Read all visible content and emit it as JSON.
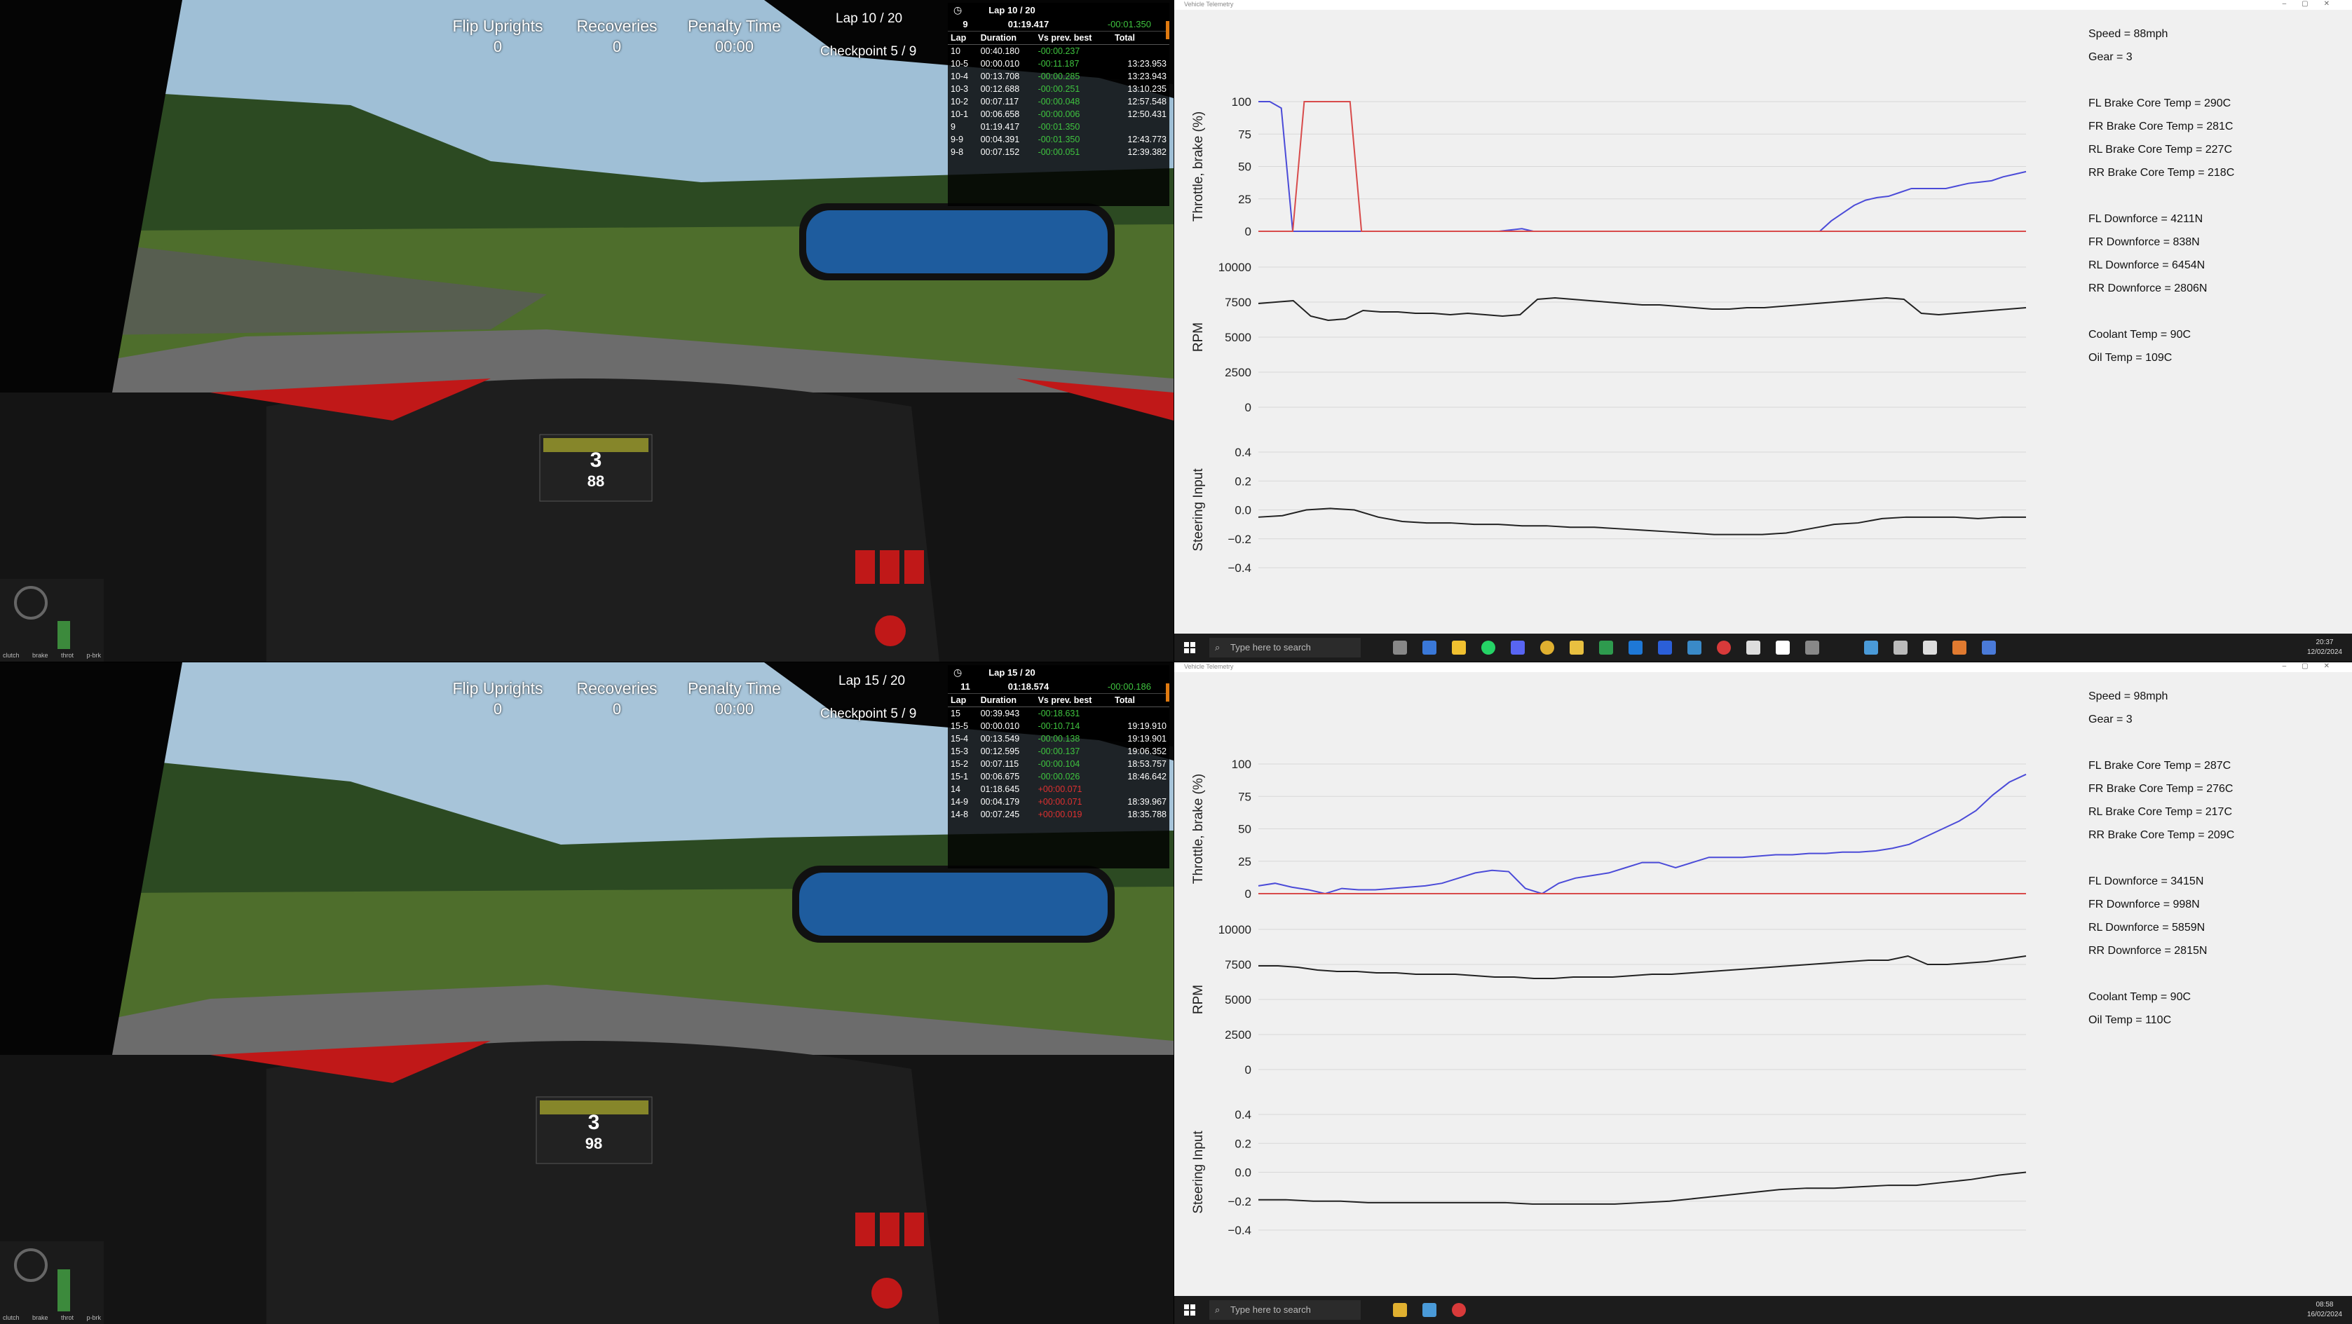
{
  "top": {
    "hud": {
      "flip_label": "Flip Uprights",
      "flip_value": "0",
      "rec_label": "Recoveries",
      "rec_value": "0",
      "pen_label": "Penalty Time",
      "pen_value": "00:00",
      "lap": "Lap 10 / 20",
      "checkpoint": "Checkpoint 5 / 9"
    },
    "lapbox": {
      "title": "Lap 10 / 20",
      "best_lap": "9",
      "best_time": "01:19.417",
      "best_delta": "-00:01.350",
      "headers": [
        "Lap",
        "Duration",
        "Vs prev. best",
        "Total"
      ],
      "rows": [
        {
          "lap": "10",
          "dur": "00:40.180",
          "vs": "-00:00.237",
          "tot": "",
          "vc": "green"
        },
        {
          "lap": "10-5",
          "dur": "00:00.010",
          "vs": "-00:11.187",
          "tot": "13:23.953",
          "vc": "green"
        },
        {
          "lap": "10-4",
          "dur": "00:13.708",
          "vs": "-00:00.285",
          "tot": "13:23.943",
          "vc": "green"
        },
        {
          "lap": "10-3",
          "dur": "00:12.688",
          "vs": "-00:00.251",
          "tot": "13:10.235",
          "vc": "green"
        },
        {
          "lap": "10-2",
          "dur": "00:07.117",
          "vs": "-00:00.048",
          "tot": "12:57.548",
          "vc": "green"
        },
        {
          "lap": "10-1",
          "dur": "00:06.658",
          "vs": "-00:00.006",
          "tot": "12:50.431",
          "vc": "green"
        },
        {
          "lap": "9",
          "dur": "01:19.417",
          "vs": "-00:01.350",
          "tot": "",
          "vc": "green"
        },
        {
          "lap": "9-9",
          "dur": "00:04.391",
          "vs": "-00:01.350",
          "tot": "12:43.773",
          "vc": "green"
        },
        {
          "lap": "9-8",
          "dur": "00:07.152",
          "vs": "-00:00.051",
          "tot": "12:39.382",
          "vc": "green"
        }
      ]
    },
    "dash": {
      "gear": "3",
      "speed": "88"
    },
    "readouts": [
      "Speed = 88mph",
      "Gear = 3",
      "",
      "FL Brake Core Temp = 290C",
      "FR Brake Core Temp = 281C",
      "RL Brake Core Temp = 227C",
      "RR Brake Core Temp = 218C",
      "",
      "FL Downforce = 4211N",
      "FR Downforce = 838N",
      "RL Downforce = 6454N",
      "RR Downforce = 2806N",
      "",
      "Coolant Temp = 90C",
      "Oil Temp = 109C"
    ],
    "window_title": "Vehicle Telemetry",
    "clock": [
      "20:37",
      "12/02/2024"
    ]
  },
  "bottom": {
    "hud": {
      "flip_label": "Flip Uprights",
      "flip_value": "0",
      "rec_label": "Recoveries",
      "rec_value": "0",
      "pen_label": "Penalty Time",
      "pen_value": "00:00",
      "lap": "Lap 15 / 20",
      "checkpoint": "Checkpoint 5 / 9"
    },
    "lapbox": {
      "title": "Lap 15 / 20",
      "best_lap": "11",
      "best_time": "01:18.574",
      "best_delta": "-00:00.186",
      "headers": [
        "Lap",
        "Duration",
        "Vs prev. best",
        "Total"
      ],
      "rows": [
        {
          "lap": "15",
          "dur": "00:39.943",
          "vs": "-00:18.631",
          "tot": "",
          "vc": "green"
        },
        {
          "lap": "15-5",
          "dur": "00:00.010",
          "vs": "-00:10.714",
          "tot": "19:19.910",
          "vc": "green"
        },
        {
          "lap": "15-4",
          "dur": "00:13.549",
          "vs": "-00:00.138",
          "tot": "19:19.901",
          "vc": "green"
        },
        {
          "lap": "15-3",
          "dur": "00:12.595",
          "vs": "-00:00.137",
          "tot": "19:06.352",
          "vc": "green"
        },
        {
          "lap": "15-2",
          "dur": "00:07.115",
          "vs": "-00:00.104",
          "tot": "18:53.757",
          "vc": "green"
        },
        {
          "lap": "15-1",
          "dur": "00:06.675",
          "vs": "-00:00.026",
          "tot": "18:46.642",
          "vc": "green"
        },
        {
          "lap": "14",
          "dur": "01:18.645",
          "vs": "+00:00.071",
          "tot": "",
          "vc": "red"
        },
        {
          "lap": "14-9",
          "dur": "00:04.179",
          "vs": "+00:00.071",
          "tot": "18:39.967",
          "vc": "red"
        },
        {
          "lap": "14-8",
          "dur": "00:07.245",
          "vs": "+00:00.019",
          "tot": "18:35.788",
          "vc": "red"
        }
      ]
    },
    "dash": {
      "gear": "3",
      "speed": "98"
    },
    "readouts": [
      "Speed = 98mph",
      "Gear = 3",
      "",
      "FL Brake Core Temp = 287C",
      "FR Brake Core Temp = 276C",
      "RL Brake Core Temp = 217C",
      "RR Brake Core Temp = 209C",
      "",
      "FL Downforce = 3415N",
      "FR Downforce = 998N",
      "RL Downforce = 5859N",
      "RR Downforce = 2815N",
      "",
      "Coolant Temp = 90C",
      "Oil Temp = 110C"
    ],
    "window_title": "Vehicle Telemetry",
    "clock": [
      "08:58",
      "16/02/2024"
    ]
  },
  "taskbar": {
    "search_placeholder": "Type here to search"
  },
  "pedal_labels": [
    "clutch",
    "brake",
    "throt",
    "p-brk"
  ],
  "axis": {
    "throttle_label": "Throttle, brake (%)",
    "rpm_label": "RPM",
    "steer_label": "Steering Input",
    "throttle_ticks": [
      "100",
      "75",
      "50",
      "25",
      "0"
    ],
    "rpm_ticks": [
      "10000",
      "7500",
      "5000",
      "2500",
      "0"
    ],
    "steer_ticks": [
      "0.4",
      "0.2",
      "0.0",
      "−0.2",
      "−0.4"
    ]
  },
  "chart_data": [
    {
      "type": "line",
      "title": "",
      "ylabel": "Throttle, brake (%)",
      "ylim": [
        0,
        100
      ],
      "series": [
        {
          "color": "#4b4bd8",
          "values": [
            100,
            100,
            95,
            0,
            0,
            0,
            0,
            0,
            0,
            0,
            0,
            0,
            0,
            0,
            0,
            0,
            0,
            0,
            0,
            0,
            0,
            0,
            1,
            2,
            0,
            0,
            0,
            0,
            0,
            0,
            0,
            0,
            0,
            0,
            0,
            0,
            0,
            0,
            0,
            0,
            0,
            0,
            0,
            0,
            0,
            0,
            0,
            0,
            0,
            0,
            8,
            14,
            20,
            24,
            26,
            27,
            30,
            33,
            33,
            33,
            33,
            35,
            37,
            38,
            39,
            42,
            44,
            46
          ]
        },
        {
          "color": "#d84b4b",
          "values": [
            0,
            0,
            0,
            0,
            100,
            100,
            100,
            100,
            100,
            0,
            0,
            0,
            0,
            0,
            0,
            0,
            0,
            0,
            0,
            0,
            0,
            0,
            0,
            0,
            0,
            0,
            0,
            0,
            0,
            0,
            0,
            0,
            0,
            0,
            0,
            0,
            0,
            0,
            0,
            0,
            0,
            0,
            0,
            0,
            0,
            0,
            0,
            0,
            0,
            0,
            0,
            0,
            0,
            0,
            0,
            0,
            0,
            0,
            0,
            0,
            0,
            0,
            0,
            0,
            0,
            0,
            0,
            0
          ]
        }
      ]
    },
    {
      "type": "line",
      "ylabel": "RPM",
      "ylim": [
        0,
        10000
      ],
      "series": [
        {
          "color": "#222222",
          "values": [
            7400,
            7500,
            7600,
            6500,
            6200,
            6300,
            6900,
            6800,
            6800,
            6700,
            6700,
            6600,
            6700,
            6600,
            6500,
            6600,
            7700,
            7800,
            7700,
            7600,
            7500,
            7400,
            7300,
            7300,
            7200,
            7100,
            7000,
            7000,
            7100,
            7100,
            7200,
            7300,
            7400,
            7500,
            7600,
            7700,
            7800,
            7700,
            6700,
            6600,
            6700,
            6800,
            6900,
            7000,
            7100
          ]
        }
      ]
    },
    {
      "type": "line",
      "ylabel": "Steering Input",
      "ylim": [
        -0.4,
        0.4
      ],
      "series": [
        {
          "color": "#222222",
          "values": [
            -0.05,
            -0.04,
            0.0,
            0.01,
            0.0,
            -0.05,
            -0.08,
            -0.09,
            -0.09,
            -0.1,
            -0.1,
            -0.11,
            -0.11,
            -0.12,
            -0.12,
            -0.13,
            -0.14,
            -0.15,
            -0.16,
            -0.17,
            -0.17,
            -0.17,
            -0.16,
            -0.13,
            -0.1,
            -0.09,
            -0.06,
            -0.05,
            -0.05,
            -0.05,
            -0.06,
            -0.05,
            -0.05
          ]
        }
      ]
    },
    {
      "type": "line",
      "ylabel": "Throttle, brake (%)",
      "ylim": [
        0,
        100
      ],
      "series": [
        {
          "color": "#4b4bd8",
          "values": [
            6,
            8,
            5,
            3,
            0,
            4,
            3,
            3,
            4,
            5,
            6,
            8,
            12,
            16,
            18,
            17,
            4,
            0,
            8,
            12,
            14,
            16,
            20,
            24,
            24,
            20,
            24,
            28,
            28,
            28,
            29,
            30,
            30,
            31,
            31,
            32,
            32,
            33,
            35,
            38,
            44,
            50,
            56,
            64,
            76,
            86,
            92
          ]
        },
        {
          "color": "#d84b4b",
          "values": [
            0,
            0,
            0,
            0,
            0,
            0,
            0,
            0,
            0,
            0,
            0,
            0,
            0,
            0,
            0,
            0,
            0,
            0,
            0,
            0,
            0,
            0,
            0,
            0,
            0,
            0,
            0,
            0,
            0,
            0,
            0,
            0,
            0,
            0,
            0,
            0,
            0,
            0,
            0,
            0,
            0,
            0,
            0,
            0,
            0,
            0,
            0
          ]
        }
      ]
    },
    {
      "type": "line",
      "ylabel": "RPM",
      "ylim": [
        0,
        10000
      ],
      "series": [
        {
          "color": "#222222",
          "values": [
            7400,
            7400,
            7300,
            7100,
            7000,
            7000,
            6900,
            6900,
            6800,
            6800,
            6800,
            6700,
            6600,
            6600,
            6500,
            6500,
            6600,
            6600,
            6600,
            6700,
            6800,
            6800,
            6900,
            7000,
            7100,
            7200,
            7300,
            7400,
            7500,
            7600,
            7700,
            7800,
            7800,
            8100,
            7500,
            7500,
            7600,
            7700,
            7900,
            8100
          ]
        }
      ]
    },
    {
      "type": "line",
      "ylabel": "Steering Input",
      "ylim": [
        -0.4,
        0.4
      ],
      "series": [
        {
          "color": "#222222",
          "values": [
            -0.19,
            -0.19,
            -0.2,
            -0.2,
            -0.21,
            -0.21,
            -0.21,
            -0.21,
            -0.21,
            -0.21,
            -0.22,
            -0.22,
            -0.22,
            -0.22,
            -0.21,
            -0.2,
            -0.18,
            -0.16,
            -0.14,
            -0.12,
            -0.11,
            -0.11,
            -0.1,
            -0.09,
            -0.09,
            -0.07,
            -0.05,
            -0.02,
            0.0
          ]
        }
      ]
    }
  ]
}
